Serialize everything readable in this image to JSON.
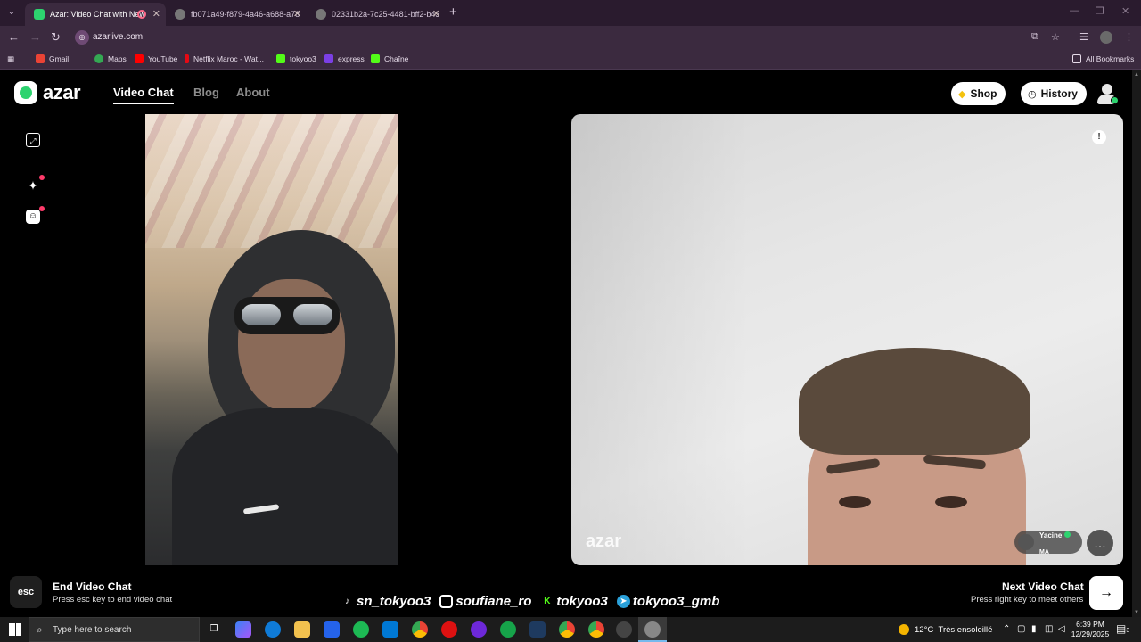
{
  "browser": {
    "tabs": [
      {
        "title": "Azar: Video Chat with New",
        "active": true
      },
      {
        "title": "fb071a49-f879-4a46-a688-a78",
        "active": false
      },
      {
        "title": "02331b2a-7c25-4481-bff2-b43",
        "active": false
      }
    ],
    "url": "azarlive.com",
    "bookmarks": [
      {
        "label": "Gmail",
        "color": "#ea4335"
      },
      {
        "label": "Maps",
        "color": "#34a853"
      },
      {
        "label": "YouTube",
        "color": "#ff0000"
      },
      {
        "label": "Netflix Maroc - Wat...",
        "color": "#e50914"
      },
      {
        "label": "tokyoo3",
        "color": "#53fc18"
      },
      {
        "label": "express",
        "color": "#7b3fe4"
      },
      {
        "label": "Chaîne",
        "color": "#53fc18"
      }
    ],
    "all_bookmarks": "All Bookmarks"
  },
  "header": {
    "logo": "azar",
    "nav": [
      {
        "label": "Video Chat",
        "active": true
      },
      {
        "label": "Blog",
        "active": false
      },
      {
        "label": "About",
        "active": false
      }
    ],
    "shop_label": "Shop",
    "history_label": "History"
  },
  "remote": {
    "watermark": "azar",
    "user_name": "Yacine",
    "country": "MA"
  },
  "footer": {
    "esc_key": "esc",
    "end_title": "End Video Chat",
    "end_sub": "Press esc key to end video chat",
    "next_title": "Next Video Chat",
    "next_sub": "Press right key to meet others",
    "socials": [
      {
        "platform": "tiktok",
        "handle": "sn_tokyoo3"
      },
      {
        "platform": "instagram",
        "handle": "soufiane_ro"
      },
      {
        "platform": "kick",
        "handle": "tokyoo3"
      },
      {
        "platform": "telegram",
        "handle": "tokyoo3_gmb"
      }
    ]
  },
  "taskbar": {
    "search_placeholder": "Type here to search",
    "weather_temp": "12°C",
    "weather_desc": "Très ensoleillé",
    "time": "6:39 PM",
    "date": "12/29/2025",
    "notifications": "3"
  }
}
